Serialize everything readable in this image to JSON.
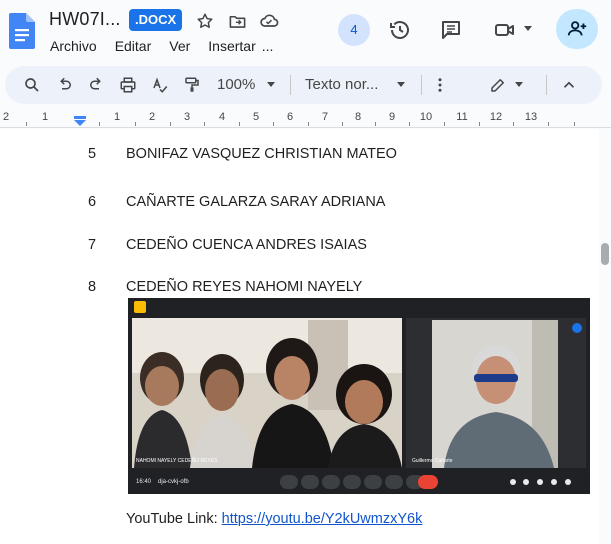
{
  "header": {
    "doc_title": "HW07I...",
    "ext_badge": ".DOCX",
    "collaborator_count": "4",
    "menu": [
      "Archivo",
      "Editar",
      "Ver",
      "Insertar",
      "..."
    ]
  },
  "toolbar": {
    "zoom": "100%",
    "style": "Texto nor..."
  },
  "ruler": {
    "numbers": [
      "2",
      "1",
      "1",
      "2",
      "3",
      "4",
      "5",
      "6",
      "7",
      "8",
      "9",
      "10",
      "11",
      "12",
      "13"
    ]
  },
  "students": [
    {
      "num": "5",
      "name": "BONIFAZ VASQUEZ CHRISTIAN MATEO"
    },
    {
      "num": "6",
      "name": "CAÑARTE GALARZA SARAY ADRIANA"
    },
    {
      "num": "7",
      "name": "CEDEÑO CUENCA ANDRES ISAIAS"
    },
    {
      "num": "8",
      "name": "CEDEÑO REYES NAHOMI NAYELY"
    }
  ],
  "video": {
    "tile_left_label": "NAHOMI NAYELY CEDEÑO REYES",
    "tile_right_label": "Guillermo Cañarte",
    "time": "16:40",
    "meeting_code": "dja-cvkj-ofb"
  },
  "youtube": {
    "label": "YouTube Link:",
    "url": "https://youtu.be/Y2kUwmzxY6k"
  },
  "colors": {
    "accent": "#1a73e8",
    "share_bg": "#c2e7ff",
    "link": "#1155cc"
  }
}
